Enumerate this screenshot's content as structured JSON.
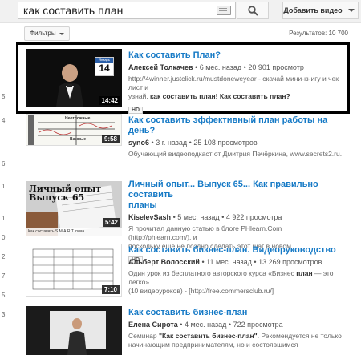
{
  "search": {
    "query": "как составить план",
    "upload_label": "Добавить видео"
  },
  "filters": {
    "label": "Фильтры",
    "results": "Результатов: 10 700"
  },
  "left_numbers": [
    "5",
    "4",
    "6",
    "1",
    "1",
    "0",
    "2",
    "7",
    "5",
    "3"
  ],
  "results": [
    {
      "title": "Как составить План?",
      "author": "Алексей Толкачев",
      "age": "6 мес. назад",
      "views": "20 901 просмотр",
      "desc1": "http://4winner.justclick.ru/mustdoneweyear - скачай мини-книгу и чек лист и",
      "desc2_prefix": "узнай, ",
      "desc2_bold": "как составить план! Как составить план?",
      "badge": "HD",
      "duration": "14:42",
      "calendar_month": "Январь",
      "calendar_day": "14"
    },
    {
      "title": "Как составить эффективный план работы на день?",
      "author": "syno6",
      "age": "3 г. назад",
      "views": "25 108 просмотров",
      "desc1": "Обучающий видеоподкаст от Дмитрия Печёркина, www.secrets2.ru.",
      "duration": "9:58",
      "paper_head": "Неотложные",
      "paper_mid": "Важные"
    },
    {
      "title": "Личный опыт... Выпуск 65... Как правильно составить",
      "title2": "планы",
      "author": "KiselevSash",
      "age": "5 мес. назад",
      "views": "4 922 просмотра",
      "desc1": "Я прочитал данную статью в блоге PHlearn.Com (http://phlearn.com/), и",
      "desc2": "поскольку ещё не поздно сделать этот шаг в новом ...",
      "badge": "HD",
      "duration": "5:42",
      "overlay_title": "Личный опыт\nВыпуск 65",
      "overlay_caption": "Как составить S.M.A.R.T. план"
    },
    {
      "title": "Как составить бизнес-план. Видеоруководство",
      "author": "Альберт Волосский",
      "age": "11 мес. назад",
      "views": "13 269 просмотров",
      "desc1_prefix": "Один урок из бесплатного авторского курса «Бизнес ",
      "desc1_bold": "план",
      "desc1_suffix": " — это легко»",
      "desc2": "(10 видеоуроков) - [http://free.commersclub.ru/]",
      "duration": "7:10"
    },
    {
      "title": "Как составить бизнес-план",
      "author": "Елена Сирота",
      "age": "4 мес. назад",
      "views": "722 просмотра",
      "desc1_prefix": "Семинар ",
      "desc1_bold": "\"Как составить бизнес-план\"",
      "desc1_suffix": ". Рекомендуется не только",
      "desc2": "начинающим предпринимателям, но и состоявшимся"
    }
  ],
  "colors": {
    "link": "#167ac6",
    "selected_outline": "#000000"
  }
}
